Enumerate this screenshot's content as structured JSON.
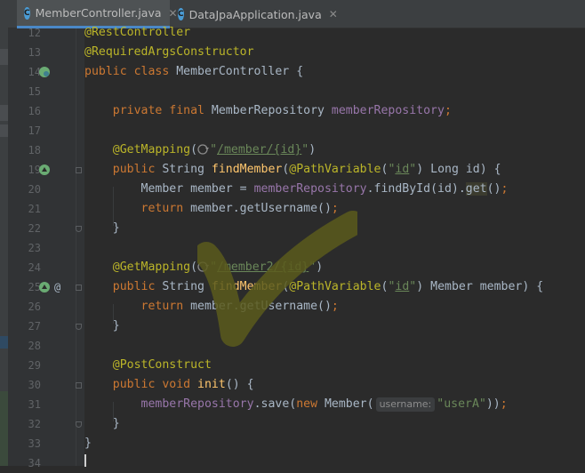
{
  "tabs": [
    {
      "label": "MemberController.java",
      "active": true,
      "icon": "class-icon"
    },
    {
      "label": "DataJpaApplication.java",
      "active": false,
      "icon": "class-icon"
    }
  ],
  "code": [
    {
      "n": "12",
      "text": "@RestController"
    },
    {
      "n": "13",
      "text": "@RequiredArgsConstructor"
    },
    {
      "n": "14",
      "text": "public class MemberController {"
    },
    {
      "n": "15",
      "text": ""
    },
    {
      "n": "16",
      "text": "    private final MemberRepository memberRepository;"
    },
    {
      "n": "17",
      "text": ""
    },
    {
      "n": "18",
      "text": "    @GetMapping(\"/member/{id}\")"
    },
    {
      "n": "19",
      "text": "    public String findMember(@PathVariable(\"id\") Long id) {"
    },
    {
      "n": "20",
      "text": "        Member member = memberRepository.findById(id).get();"
    },
    {
      "n": "21",
      "text": "        return member.getUsername();"
    },
    {
      "n": "22",
      "text": "    }"
    },
    {
      "n": "23",
      "text": ""
    },
    {
      "n": "24",
      "text": "    @GetMapping(\"/member2/{id}\")"
    },
    {
      "n": "25",
      "text": "    public String findMember(@PathVariable(\"id\") Member member) {"
    },
    {
      "n": "26",
      "text": "        return member.getUsername();"
    },
    {
      "n": "27",
      "text": "    }"
    },
    {
      "n": "28",
      "text": ""
    },
    {
      "n": "29",
      "text": "    @PostConstruct"
    },
    {
      "n": "30",
      "text": "    public void init() {"
    },
    {
      "n": "31",
      "text": "        memberRepository.save(new Member(username: \"userA\"));"
    },
    {
      "n": "32",
      "text": "    }"
    },
    {
      "n": "33",
      "text": "}"
    },
    {
      "n": "34",
      "text": ""
    }
  ],
  "hints": {
    "username": "username:"
  },
  "gutter_icons": {
    "line14": "spring-bean-icon",
    "line19": "spring-endpoint-icon",
    "line25": "spring-endpoint-icon",
    "line25_extra": "at-sign-icon"
  },
  "colors": {
    "keyword": "#cc7832",
    "annotation": "#bbb529",
    "field": "#9876aa",
    "method": "#ffc66d",
    "string": "#6a8759",
    "text": "#a9b7c6",
    "background": "#2b2b2b"
  }
}
